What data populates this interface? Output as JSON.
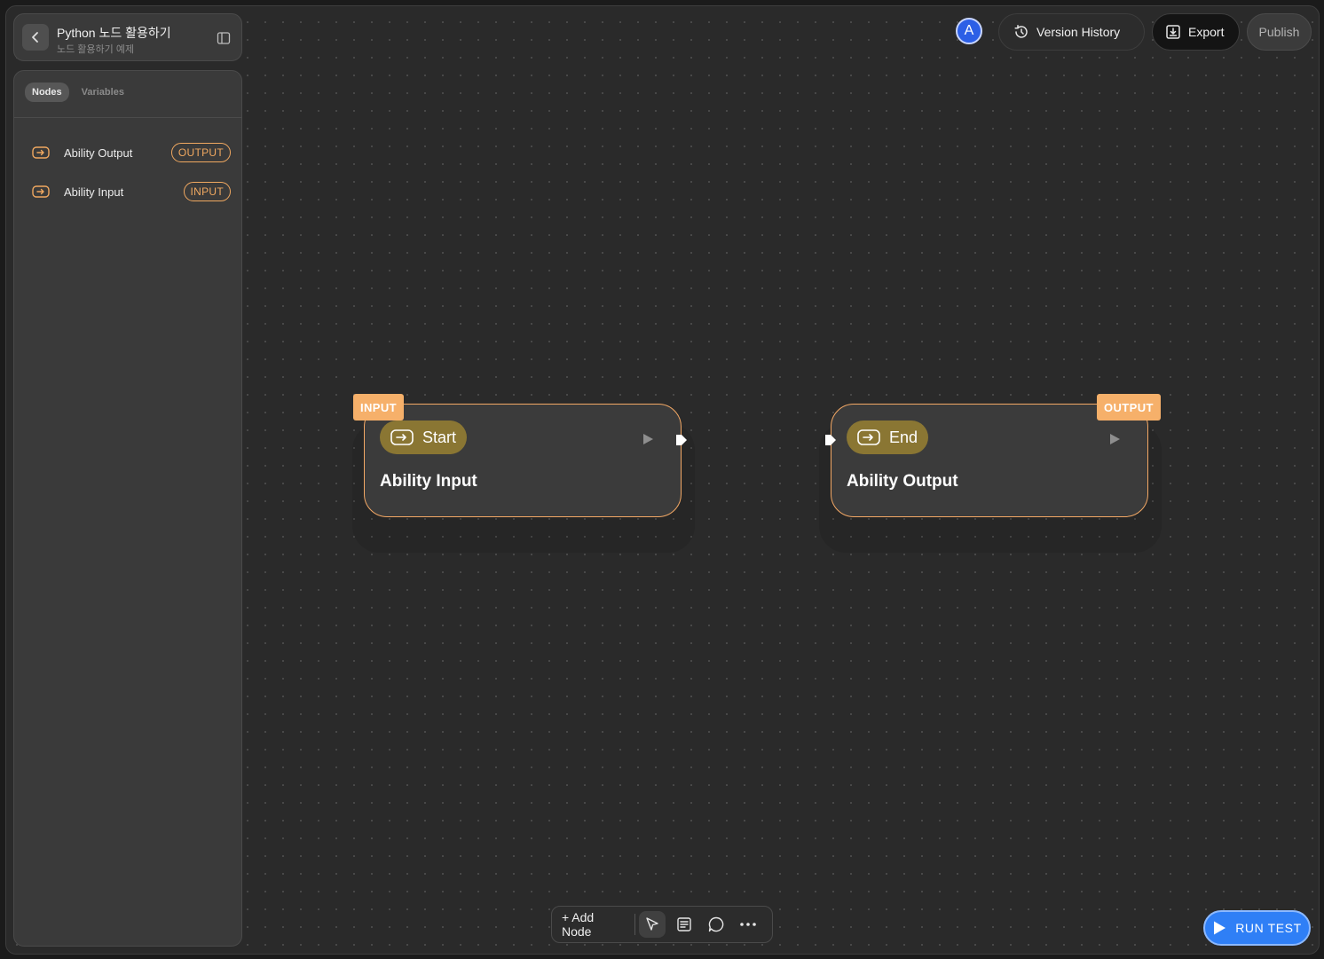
{
  "project": {
    "title": "Python 노드 활용하기",
    "subtitle": "노드 활용하기 예제",
    "back_icon": "chevron-left-icon",
    "panel_icon": "sidebar-toggle-icon"
  },
  "sidebar": {
    "tabs": [
      {
        "label": "Nodes",
        "active": true
      },
      {
        "label": "Variables",
        "active": false
      }
    ],
    "nodes": [
      {
        "label": "Ability Output",
        "badge": "OUTPUT",
        "icon": "arrow-box-icon"
      },
      {
        "label": "Ability Input",
        "badge": "INPUT",
        "icon": "arrow-box-icon"
      }
    ]
  },
  "topbar": {
    "avatar_letter": "A",
    "version_history": "Version History",
    "export": "Export",
    "publish": "Publish"
  },
  "canvas": {
    "nodes": [
      {
        "tag": "INPUT",
        "pill": "Start",
        "title": "Ability Input"
      },
      {
        "tag": "OUTPUT",
        "pill": "End",
        "title": "Ability Output"
      }
    ]
  },
  "toolbar": {
    "add_node": "+ Add Node",
    "icons": [
      "pointer-icon",
      "note-icon",
      "comment-icon",
      "more-icon"
    ]
  },
  "run_test": "RUN TEST",
  "colors": {
    "accent_orange": "#f3a865",
    "pill_olive": "#8a7633",
    "run_blue": "#2f7ff6",
    "avatar_blue": "#2c5fe6"
  }
}
